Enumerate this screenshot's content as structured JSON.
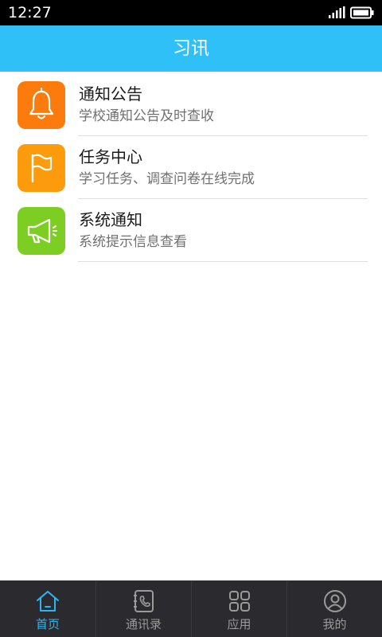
{
  "status_bar": {
    "time": "12:27"
  },
  "app": {
    "title": "习讯"
  },
  "list": {
    "items": [
      {
        "title": "通知公告",
        "subtitle": "学校通知公告及时查收",
        "icon": "bell-icon",
        "color": "#fb7c0c"
      },
      {
        "title": "任务中心",
        "subtitle": "学习任务、调查问卷在线完成",
        "icon": "flag-icon",
        "color": "#fc9b0c"
      },
      {
        "title": "系统通知",
        "subtitle": "系统提示信息查看",
        "icon": "megaphone-icon",
        "color": "#7dce22"
      }
    ]
  },
  "tab_bar": {
    "tabs": [
      {
        "label": "首页",
        "icon": "home-icon",
        "active": true
      },
      {
        "label": "通讯录",
        "icon": "contacts-phone-icon",
        "active": false
      },
      {
        "label": "应用",
        "icon": "apps-grid-icon",
        "active": false
      },
      {
        "label": "我的",
        "icon": "profile-icon",
        "active": false
      }
    ]
  },
  "colors": {
    "title_bar": "#2fc0f7",
    "tab_bar": "#2b2b2f",
    "tab_active": "#2fb6f0",
    "tab_inactive": "#9a9a9a"
  }
}
